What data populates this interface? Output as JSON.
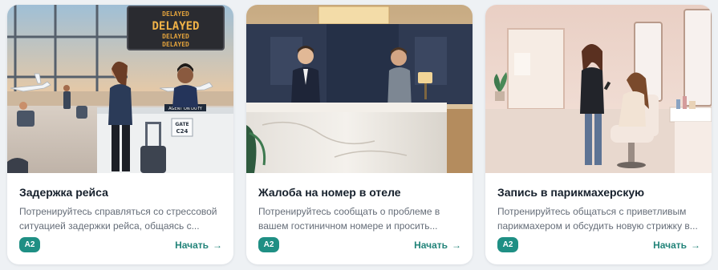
{
  "lessons": [
    {
      "title": "Задержка рейса",
      "description": "Потренируйтесь справляться со стрессовой ситуацией задержки рейса, общаясь с...",
      "level": "A2",
      "start_label": "Начать",
      "arrow_icon": "arrow-right-icon",
      "illustration": {
        "board_lines": [
          "DELAYED",
          "DELAYED",
          "DELAYED",
          "DELAYED"
        ],
        "counter_sign": "AGENT ON DUTY",
        "gate_sign": [
          "GATE",
          "C24"
        ]
      }
    },
    {
      "title": "Жалоба на номер в отеле",
      "description": "Потренируйтесь сообщать о проблеме в вашем гостиничном номере и просить...",
      "level": "A2",
      "start_label": "Начать",
      "arrow_icon": "arrow-right-icon"
    },
    {
      "title": "Запись в парикмахерскую",
      "description": "Потренируйтесь общаться с приветливым парикмахером и обсудить новую стрижку в...",
      "level": "A2",
      "start_label": "Начать",
      "arrow_icon": "arrow-right-icon"
    }
  ],
  "colors": {
    "accent": "#1f8f84",
    "link": "#23847a",
    "title": "#16202c",
    "description": "#656d78",
    "background": "#eef1f4",
    "card": "#ffffff"
  }
}
